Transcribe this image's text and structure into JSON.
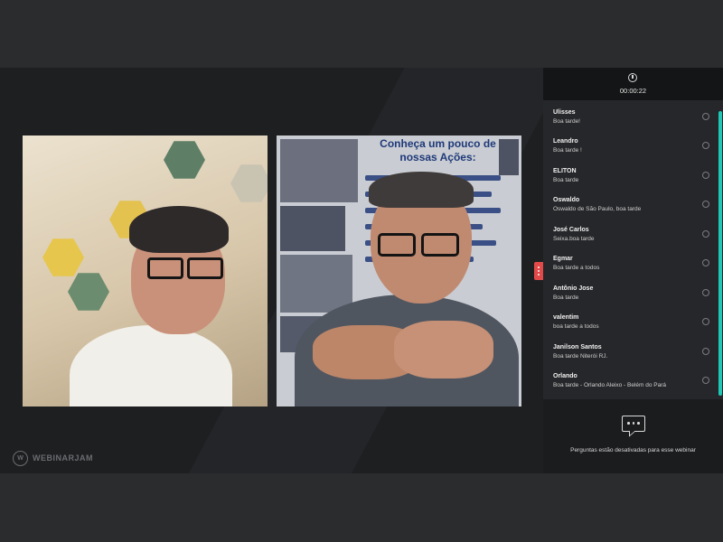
{
  "app": {
    "logo_text": "WEBINARJAM"
  },
  "timer": {
    "elapsed": "00:00:22"
  },
  "chat": {
    "messages": [
      {
        "name": "Ulisses",
        "text": "Boa tarde!"
      },
      {
        "name": "Leandro",
        "text": "Boa tarde !"
      },
      {
        "name": "ELITON",
        "text": "Boa tarde"
      },
      {
        "name": "Oswaldo",
        "text": "Oswaldo de São Paulo, boa tarde"
      },
      {
        "name": "José Carlos",
        "text": "Seixa.boa tarde"
      },
      {
        "name": "Egmar",
        "text": "Boa tarde a todos"
      },
      {
        "name": "Antônio Jose",
        "text": "Boa tarde"
      },
      {
        "name": "valentim",
        "text": "boa tarde a todos"
      },
      {
        "name": "Janilson Santos",
        "text": "Boa tarde Niterói RJ."
      },
      {
        "name": "Orlando",
        "text": "Boa tarde - Orlando Aleixo - Belém do Pará"
      }
    ]
  },
  "questions": {
    "disabled_message": "Perguntas estão desativadas para esse webinar"
  },
  "poster": {
    "heading": "Conheça um pouco de nossas Ações:"
  },
  "colors": {
    "accent_scrollbar": "#1fc7b4",
    "toggle": "#e24a4a",
    "panel_bg": "#26272a"
  },
  "icons": {
    "timer": "clock-icon",
    "questions": "chat-bubble-icon",
    "toggle": "more-vertical-icon"
  }
}
